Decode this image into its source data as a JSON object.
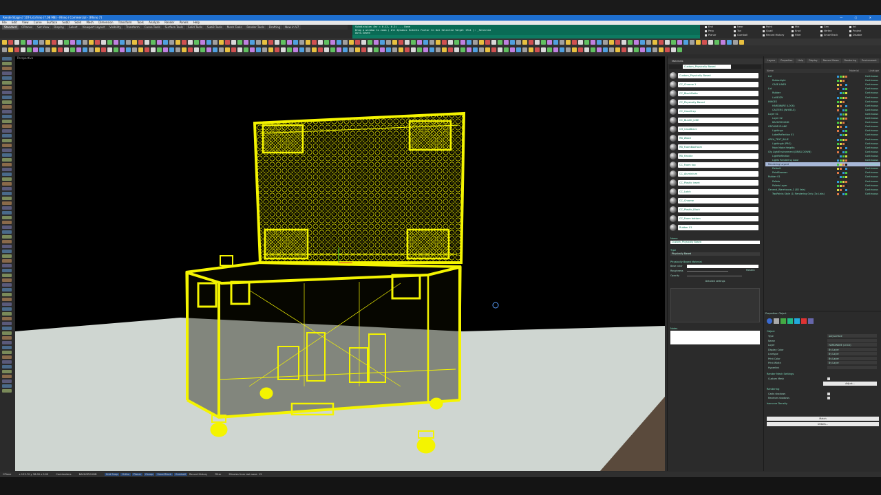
{
  "window": {
    "title": "RenderStage // 107-Lid.rhino (7.08 MB) - Rhino / Commercial - [Rhino 7]",
    "controls": [
      "—",
      "▢",
      "✕"
    ]
  },
  "menu": [
    "File",
    "Edit",
    "View",
    "Curve",
    "Surface",
    "SubD",
    "Solid",
    "Mesh",
    "Dimension",
    "Transform",
    "Tools",
    "Analyze",
    "Render",
    "Panels",
    "Help"
  ],
  "tabs": [
    "Standard",
    "CPlanes",
    "Set View",
    "Display",
    "Select",
    "Viewport Layout",
    "Visibility",
    "Transform",
    "Curve Tools",
    "Surface Tools",
    "Solid Tools",
    "SubD Tools",
    "Mesh Tools",
    "Render Tools",
    "Drafting",
    "New in V7"
  ],
  "command": {
    "history": [
      "Subdivision (hv = 0.12, 0.2) ... Done",
      "Drag a window to zoom ( All  Dynamic  Extents  Factor  In  Out  Selected  Target  1To1 ): _Selected",
      "Auto-Saved",
      "Command:"
    ]
  },
  "osnaps": [
    "End",
    "Near",
    "Point",
    "Mid",
    "Cen",
    "Int",
    "Perp",
    "Tan",
    "Quad",
    "Knot",
    "Vertex",
    "Project",
    "Planar",
    "Gumball",
    "Record History",
    "Filter",
    "SmartTrack",
    "Disable"
  ],
  "viewport": {
    "label": "Perspective"
  },
  "materials": {
    "panel_title": "Materials",
    "search_value": "Custom_Physically Based",
    "items": [
      "Custom_Physically Based",
      "CC_Chrome 1",
      "CC_BlackMatte",
      "CC_Physically Based",
      "CC_CaseGrey",
      "CC_BLACK_LINE",
      "CH_CaseBlack",
      "RB_Wood",
      "RB_FoamBoxFoam",
      "RB_Handle",
      "CC_Foam top",
      "CC_Aluminium",
      "CC_Plastic insert",
      "CC_Latch",
      "CC_Chrome",
      "CC_Plastic_Black",
      "CC_Foam bottom",
      "Rubber 01"
    ],
    "name_section": "Name",
    "name_value": "Custom_Physically Based",
    "type_section": "Type",
    "type_value": "Physically Based",
    "pbr_section": "Physically Based Material",
    "base_color_label": "Base color",
    "roughness_label": "Roughness",
    "metallic_label": "Metallic",
    "opacity_label": "Opacity",
    "detailed_label": "Detailed settings",
    "notes_label": "Notes"
  },
  "layers": {
    "tabs": [
      "Layers",
      "Properties",
      "Help",
      "Display",
      "Named Views",
      "Rendering",
      "Environment"
    ],
    "col_name": "Name",
    "col_material": "Material",
    "col_linetype": "Linetype",
    "rows": [
      {
        "name": "Lid",
        "mat": "Continuous"
      },
      {
        "name": "Rubberlight",
        "mat": "Continuous"
      },
      {
        "name": "CASE LINER",
        "mat": "Continuous"
      },
      {
        "name": "Lid",
        "mat": "Continuous"
      },
      {
        "name": "Rubber",
        "mat": "Continuous"
      },
      {
        "name": "Lid BODY",
        "mat": "Continuous"
      },
      {
        "name": "HINGES",
        "mat": "Continuous"
      },
      {
        "name": "HARDWARE (LOCK)",
        "mat": "Continuous"
      },
      {
        "name": "CASTERS (WHEELS)",
        "mat": "Continuous"
      },
      {
        "name": "Layer 01",
        "mat": "Continuous"
      },
      {
        "name": "Layer 02",
        "mat": "Continuous"
      },
      {
        "name": "BACKGROUND",
        "mat": "Continuous"
      },
      {
        "name": "GROUND PLANE",
        "mat": "Continuous"
      },
      {
        "name": "Lightings",
        "mat": "Continuous"
      },
      {
        "name": "LabelReflection 01",
        "mat": "Continuous"
      },
      {
        "name": "AREA_TEXT_BLUE",
        "mat": "Continuous"
      },
      {
        "name": "Lightingle (PRO)",
        "mat": "Continuous"
      },
      {
        "name": "Main Mode Heights",
        "mat": "Continuous"
      },
      {
        "name": "Cfg LightEnvironment (DRAG DOWN)",
        "mat": "Continuous"
      },
      {
        "name": "LightReflection",
        "mat": "Continuous"
      },
      {
        "name": "Lights Rendering Color",
        "mat": "Continuous"
      },
      {
        "name": "Rendering Layout",
        "mat": "Continuous"
      },
      {
        "name": "Default",
        "mat": "Continuous"
      },
      {
        "name": "PointBrowser",
        "mat": "Continuous"
      },
      {
        "name": "Rubber 01",
        "mat": "Continuous"
      },
      {
        "name": "Pallets",
        "mat": "Continuous"
      },
      {
        "name": "Pallets Layer",
        "mat": "Continuous"
      },
      {
        "name": "General_Warehouse_1 (3D lists)",
        "mat": "Continuous"
      },
      {
        "name": "TwoPoints Style (1) Rendering Only (3x Lists)",
        "mat": "Continuous"
      }
    ]
  },
  "properties": {
    "title": "Properties: Object",
    "section_object": "Object",
    "rows": [
      {
        "label": "Type",
        "value": "polysurface"
      },
      {
        "label": "Name",
        "value": ""
      },
      {
        "label": "Layer",
        "value": "HARDWARE (LOCK)"
      },
      {
        "label": "Display Color",
        "value": "By Layer"
      },
      {
        "label": "Linetype",
        "value": "By Layer"
      },
      {
        "label": "Print Color",
        "value": "By Layer"
      },
      {
        "label": "Print Width",
        "value": "By Layer"
      },
      {
        "label": "Hyperlink",
        "value": ""
      }
    ],
    "section_mesh": "Render Mesh Settings",
    "custom_mesh": "Custom Mesh",
    "adjust_label": "Adjust...",
    "section_rendering": "Rendering",
    "casts_shadows": "Casts shadows",
    "receives_shadows": "Receives shadows",
    "section_isocurve": "Isocurve Density",
    "match_label": "Match",
    "details_label": "Details..."
  },
  "status": {
    "cplane": "CPlane",
    "coords": "x 123.70  y 36.00  z 0.00",
    "units": "Centimeters",
    "layer": "BACKGROUND",
    "chips": [
      "Grid Snap",
      "Ortho",
      "Planar",
      "Osnap",
      "SmartTrack",
      "Gumball"
    ],
    "history": "Record History",
    "filter": "Filter",
    "message": "Minutes from last save: 13"
  },
  "colors": {
    "accent_title": "#1e6fd0",
    "command_bg": "#0a6b55",
    "wire": "#f4f400",
    "label_text": "#7fe0c0"
  }
}
